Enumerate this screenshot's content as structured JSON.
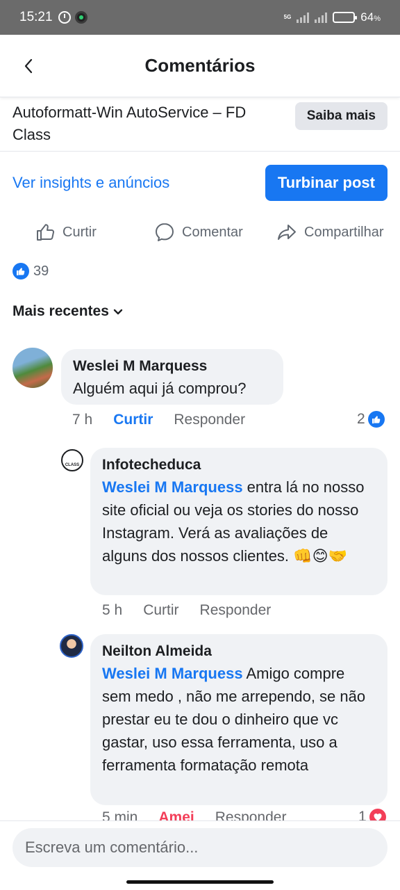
{
  "status_bar": {
    "time": "15:21",
    "network": "5G",
    "battery": "64",
    "battery_unit": "%",
    "icons": [
      "alarm-icon",
      "app-notification-icon",
      "signal-icon",
      "battery-icon"
    ]
  },
  "header": {
    "title": "Comentários",
    "back_icon": "chevron-left-icon"
  },
  "ad": {
    "title": "Autoformatt-Win AutoService – FD Class",
    "button": "Saiba mais"
  },
  "insights": {
    "link": "Ver insights e anúncios",
    "boost_button": "Turbinar post"
  },
  "actions": {
    "like": "Curtir",
    "comment": "Comentar",
    "share": "Compartilhar"
  },
  "reactions": {
    "count": "39"
  },
  "sort": {
    "label": "Mais recentes"
  },
  "comments": [
    {
      "author": "Weslei M Marquess",
      "text": "Alguém aqui já comprou?",
      "time": "7 h",
      "like": "Curtir",
      "reply": "Responder",
      "reaction_count": "2",
      "reaction": "like"
    },
    {
      "author": "Infotecheduca",
      "mention": "Weslei M Marquess",
      "text": " entra lá no nosso site oficial ou veja os stories do nosso Instagram. Verá as avaliações de alguns dos nossos clientes. ",
      "emojis": [
        "👊",
        "😊",
        "🤝"
      ],
      "time": "5 h",
      "like": "Curtir",
      "reply": "Responder",
      "avatar_text": "CLASS"
    },
    {
      "author": "Neilton Almeida",
      "mention": "Weslei M Marquess",
      "text": " Amigo compre sem medo , não me arrependo, se não prestar eu te dou o dinheiro que vc gastar, uso essa ferramenta, uso a ferramenta formatação remota",
      "time": "5 min",
      "like": "Amei",
      "reply": "Responder",
      "reaction_count": "1",
      "reaction": "love"
    }
  ],
  "composer": {
    "placeholder": "Escreva um comentário..."
  },
  "colors": {
    "accent": "#1877f2",
    "bubble": "#f0f2f5",
    "love": "#f33e58",
    "status_bar": "#6b6b6b"
  }
}
